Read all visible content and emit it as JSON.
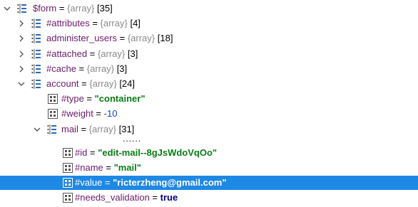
{
  "tree": {
    "root": {
      "name": "$form",
      "eq": " = ",
      "type": "{array}",
      "count": "[35]"
    },
    "attributes": {
      "name": "#attributes",
      "eq": " = ",
      "type": "{array}",
      "count": "[4]"
    },
    "administer_users": {
      "name": "administer_users",
      "eq": " = ",
      "type": "{array}",
      "count": "[18]"
    },
    "attached": {
      "name": "#attached",
      "eq": " = ",
      "type": "{array}",
      "count": "[3]"
    },
    "cache": {
      "name": "#cache",
      "eq": " = ",
      "type": "{array}",
      "count": "[3]"
    },
    "account": {
      "name": "account",
      "eq": " = ",
      "type": "{array}",
      "count": "[24]"
    },
    "type": {
      "name": "#type",
      "eq": " = ",
      "value": "\"container\""
    },
    "weight": {
      "name": "#weight",
      "eq": " = ",
      "value": "-10"
    },
    "mail": {
      "name": "mail",
      "eq": " = ",
      "type": "{array}",
      "count": "[31]"
    },
    "ellipsis": "......",
    "id": {
      "name": "#id",
      "eq": " = ",
      "value": "\"edit-mail--8gJsWdoVqOo\""
    },
    "mail_name": {
      "name": "#name",
      "eq": " = ",
      "value": "\"mail\""
    },
    "value": {
      "name": "#value",
      "eq": " = ",
      "value": "\"ricterzheng@gmail.com\""
    },
    "needs_validation": {
      "name": "#needs_validation",
      "eq": " = ",
      "value": "true"
    }
  },
  "colors": {
    "selection": "#1e88e5",
    "string": "#0a7c15",
    "number": "#1a3fbf",
    "name": "#6a1b6a",
    "type": "#8a8a8a"
  }
}
